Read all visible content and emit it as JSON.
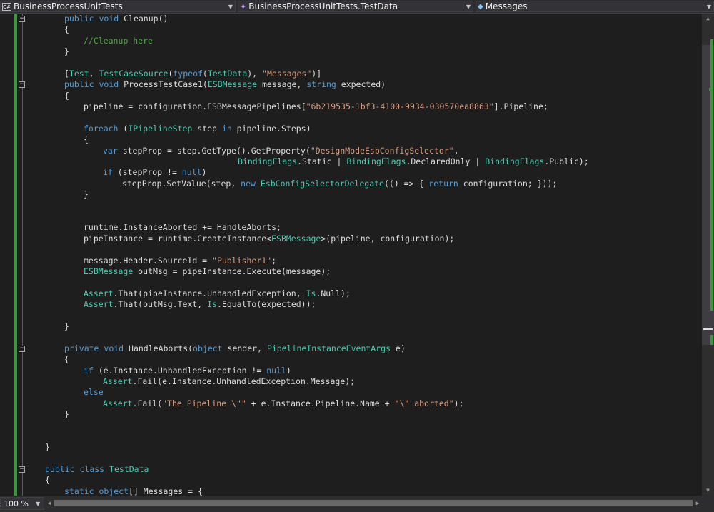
{
  "navbar": {
    "project": {
      "label": "BusinessProcessUnitTests",
      "icon": "csharp-project-icon"
    },
    "type": {
      "label": "BusinessProcessUnitTests.TestData",
      "icon": "class-icon"
    },
    "member": {
      "label": "Messages",
      "icon": "field-icon"
    }
  },
  "editor": {
    "lines": [
      [
        [
          "kw",
          "public"
        ],
        [
          "p",
          " "
        ],
        [
          "kw",
          "void"
        ],
        [
          "p",
          " Cleanup()"
        ]
      ],
      [
        [
          "p",
          "{"
        ]
      ],
      [
        [
          "cm",
          "//Cleanup here"
        ]
      ],
      [
        [
          "p",
          "}"
        ]
      ],
      [
        [
          "p",
          ""
        ]
      ],
      [
        [
          "p",
          "["
        ],
        [
          "ty",
          "Test"
        ],
        [
          "p",
          ", "
        ],
        [
          "ty",
          "TestCaseSource"
        ],
        [
          "p",
          "("
        ],
        [
          "kw",
          "typeof"
        ],
        [
          "p",
          "("
        ],
        [
          "ty",
          "TestData"
        ],
        [
          "p",
          "), "
        ],
        [
          "st",
          "\"Messages\""
        ],
        [
          "p",
          ")]"
        ]
      ],
      [
        [
          "kw",
          "public"
        ],
        [
          "p",
          " "
        ],
        [
          "kw",
          "void"
        ],
        [
          "p",
          " ProcessTestCase1("
        ],
        [
          "ty",
          "ESBMessage"
        ],
        [
          "p",
          " message, "
        ],
        [
          "kw",
          "string"
        ],
        [
          "p",
          " expected)"
        ]
      ],
      [
        [
          "p",
          "{"
        ]
      ],
      [
        [
          "p",
          "pipeline = configuration.ESBMessagePipelines["
        ],
        [
          "st",
          "\"6b219535-1bf3-4100-9934-030570ea8863\""
        ],
        [
          "p",
          "].Pipeline;"
        ]
      ],
      [
        [
          "p",
          ""
        ]
      ],
      [
        [
          "kw",
          "foreach"
        ],
        [
          "p",
          " ("
        ],
        [
          "ty",
          "IPipelineStep"
        ],
        [
          "p",
          " step "
        ],
        [
          "kw",
          "in"
        ],
        [
          "p",
          " pipeline.Steps)"
        ]
      ],
      [
        [
          "p",
          "{"
        ]
      ],
      [
        [
          "kw",
          "var"
        ],
        [
          "p",
          " stepProp = step.GetType().GetProperty("
        ],
        [
          "st",
          "\"DesignModeEsbConfigSelector\""
        ],
        [
          "p",
          ","
        ]
      ],
      [
        [
          "ty",
          "BindingFlags"
        ],
        [
          "p",
          ".Static | "
        ],
        [
          "ty",
          "BindingFlags"
        ],
        [
          "p",
          ".DeclaredOnly | "
        ],
        [
          "ty",
          "BindingFlags"
        ],
        [
          "p",
          ".Public);"
        ]
      ],
      [
        [
          "kw",
          "if"
        ],
        [
          "p",
          " (stepProp != "
        ],
        [
          "kw",
          "null"
        ],
        [
          "p",
          ")"
        ]
      ],
      [
        [
          "p",
          "stepProp.SetValue(step, "
        ],
        [
          "kw",
          "new"
        ],
        [
          "p",
          " "
        ],
        [
          "ty",
          "EsbConfigSelectorDelegate"
        ],
        [
          "p",
          "(() => { "
        ],
        [
          "kw",
          "return"
        ],
        [
          "p",
          " configuration; }));"
        ]
      ],
      [
        [
          "p",
          "}"
        ]
      ],
      [
        [
          "p",
          ""
        ]
      ],
      [
        [
          "p",
          ""
        ]
      ],
      [
        [
          "p",
          "runtime.InstanceAborted += HandleAborts;"
        ]
      ],
      [
        [
          "p",
          "pipeInstance = runtime.CreateInstance<"
        ],
        [
          "ty",
          "ESBMessage"
        ],
        [
          "p",
          ">(pipeline, configuration);"
        ]
      ],
      [
        [
          "p",
          ""
        ]
      ],
      [
        [
          "p",
          "message.Header.SourceId = "
        ],
        [
          "st",
          "\"Publisher1\""
        ],
        [
          "p",
          ";"
        ]
      ],
      [
        [
          "ty",
          "ESBMessage"
        ],
        [
          "p",
          " outMsg = pipeInstance.Execute(message);"
        ]
      ],
      [
        [
          "p",
          ""
        ]
      ],
      [
        [
          "ty",
          "Assert"
        ],
        [
          "p",
          ".That(pipeInstance.UnhandledException, "
        ],
        [
          "ty",
          "Is"
        ],
        [
          "p",
          ".Null);"
        ]
      ],
      [
        [
          "ty",
          "Assert"
        ],
        [
          "p",
          ".That(outMsg.Text, "
        ],
        [
          "ty",
          "Is"
        ],
        [
          "p",
          ".EqualTo(expected));"
        ]
      ],
      [
        [
          "p",
          ""
        ]
      ],
      [
        [
          "p",
          "}"
        ]
      ],
      [
        [
          "p",
          ""
        ]
      ],
      [
        [
          "kw",
          "private"
        ],
        [
          "p",
          " "
        ],
        [
          "kw",
          "void"
        ],
        [
          "p",
          " HandleAborts("
        ],
        [
          "kw",
          "object"
        ],
        [
          "p",
          " sender, "
        ],
        [
          "ty",
          "PipelineInstanceEventArgs"
        ],
        [
          "p",
          " e)"
        ]
      ],
      [
        [
          "p",
          "{"
        ]
      ],
      [
        [
          "kw",
          "if"
        ],
        [
          "p",
          " (e.Instance.UnhandledException != "
        ],
        [
          "kw",
          "null"
        ],
        [
          "p",
          ")"
        ]
      ],
      [
        [
          "ty",
          "Assert"
        ],
        [
          "p",
          ".Fail(e.Instance.UnhandledException.Message);"
        ]
      ],
      [
        [
          "kw",
          "else"
        ]
      ],
      [
        [
          "ty",
          "Assert"
        ],
        [
          "p",
          ".Fail("
        ],
        [
          "st",
          "\"The Pipeline \\\"\""
        ],
        [
          "p",
          " + e.Instance.Pipeline.Name + "
        ],
        [
          "st",
          "\"\\\" aborted\""
        ],
        [
          "p",
          ");"
        ]
      ],
      [
        [
          "p",
          "}"
        ]
      ],
      [
        [
          "p",
          ""
        ]
      ],
      [
        [
          "p",
          ""
        ]
      ],
      [
        [
          "p",
          "}"
        ]
      ],
      [
        [
          "p",
          ""
        ]
      ],
      [
        [
          "kw",
          "public"
        ],
        [
          "p",
          " "
        ],
        [
          "kw",
          "class"
        ],
        [
          "p",
          " "
        ],
        [
          "ty",
          "TestData"
        ]
      ],
      [
        [
          "p",
          "{"
        ]
      ],
      [
        [
          "kw",
          "static"
        ],
        [
          "p",
          " "
        ],
        [
          "kw",
          "object"
        ],
        [
          "p",
          "[] Messages = {"
        ]
      ]
    ],
    "indents": [
      2,
      2,
      3,
      2,
      0,
      2,
      2,
      2,
      3,
      0,
      3,
      3,
      4,
      11,
      4,
      5,
      3,
      0,
      0,
      3,
      3,
      0,
      3,
      3,
      0,
      3,
      3,
      0,
      2,
      0,
      2,
      2,
      3,
      4,
      3,
      4,
      2,
      0,
      0,
      1,
      0,
      1,
      1,
      2
    ],
    "fold_markers": [
      0,
      6,
      30,
      41
    ]
  },
  "statusbar": {
    "zoom": "100 %"
  },
  "colors": {
    "keyword": "#569cd6",
    "type": "#4ec9b0",
    "string": "#d69d85",
    "comment": "#57a64a",
    "change_bar": "#3a9a3a"
  }
}
